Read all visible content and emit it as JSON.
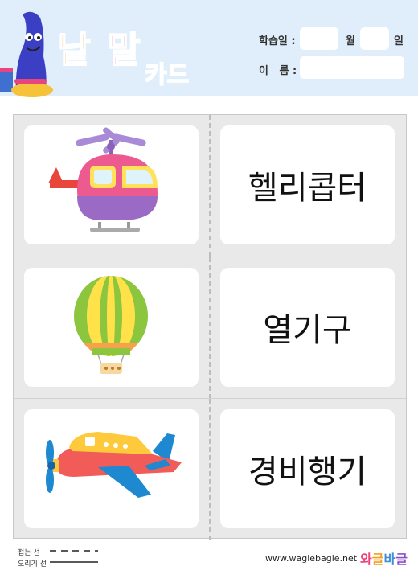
{
  "header": {
    "logo": {
      "part1": "낱",
      "part2": "말",
      "part3": "카드"
    },
    "study_date_label": "학습일 :",
    "month_label": "월",
    "day_label": "일",
    "name_label": "이   름 :"
  },
  "cards": [
    {
      "icon": "helicopter-icon",
      "word": "헬리콥터"
    },
    {
      "icon": "hot-air-balloon-icon",
      "word": "열기구"
    },
    {
      "icon": "light-airplane-icon",
      "word": "경비행기"
    }
  ],
  "footer": {
    "fold_line_label": "접는 선",
    "cut_line_label": "오리기 선",
    "website": "www.waglebagle.net",
    "brand": [
      "와",
      "글",
      "바",
      "글"
    ]
  },
  "colors": {
    "header_bg": "#dfeefa",
    "brand_colors": [
      "#f6a63a",
      "#e8457f",
      "#4a4fc7",
      "#f0a020"
    ]
  }
}
